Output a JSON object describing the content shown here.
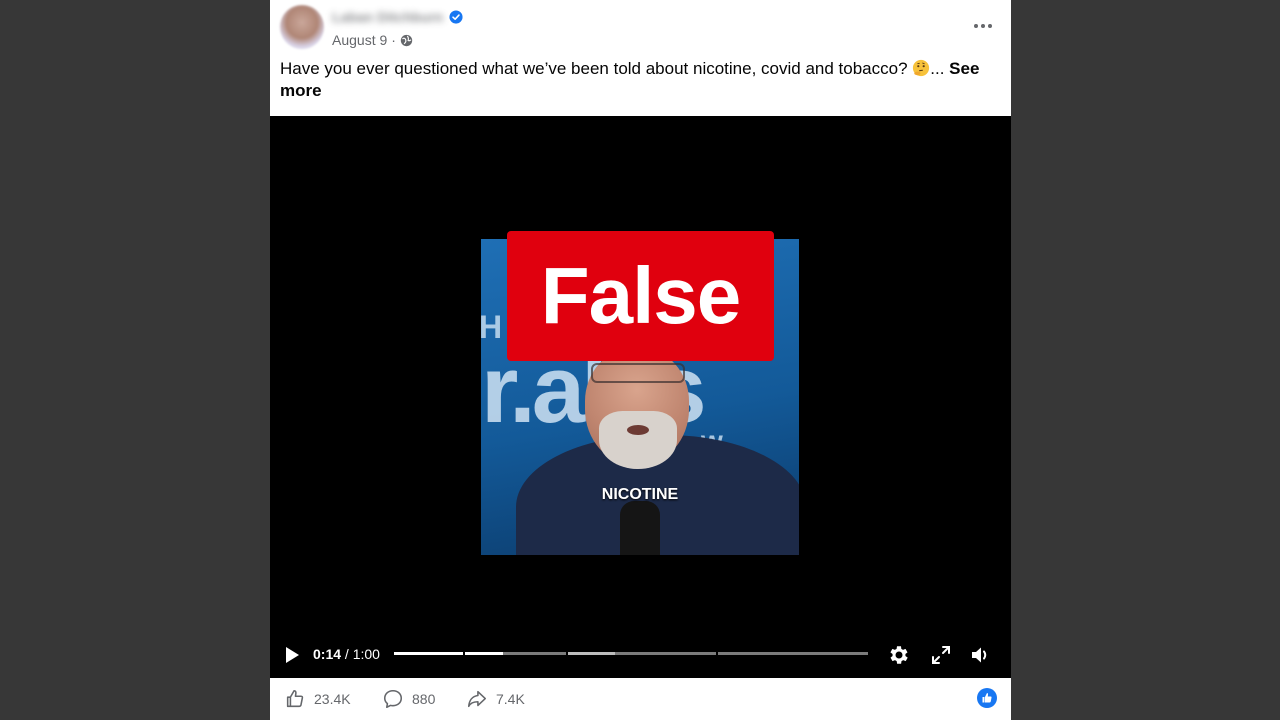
{
  "post": {
    "author_name": "Laban Ditchburn",
    "date": "August 9",
    "separator": "·",
    "caption_text": "Have you ever questioned what we’ve been told about nicotine, covid and tobacco? ",
    "caption_ellipsis": "... ",
    "see_more": "See more"
  },
  "video": {
    "rating_label": "False",
    "subtitle": "NICOTINE",
    "current_time": "0:14",
    "time_separator": " / ",
    "duration": "1:00",
    "progress_fraction": 0.23
  },
  "stats": {
    "likes": "23.4K",
    "comments": "880",
    "shares": "7.4K"
  },
  "icons": {
    "verified": "verified-badge-icon",
    "privacy": "globe-icon",
    "more": "more-options-icon",
    "play": "play-icon",
    "settings": "gear-icon",
    "fullscreen": "fullscreen-icon",
    "volume": "volume-icon",
    "like": "thumbs-up-icon",
    "comment": "comment-icon",
    "share": "share-icon"
  },
  "colors": {
    "background": "#373737",
    "false_badge": "#e0000e",
    "accent": "#1877f2"
  }
}
